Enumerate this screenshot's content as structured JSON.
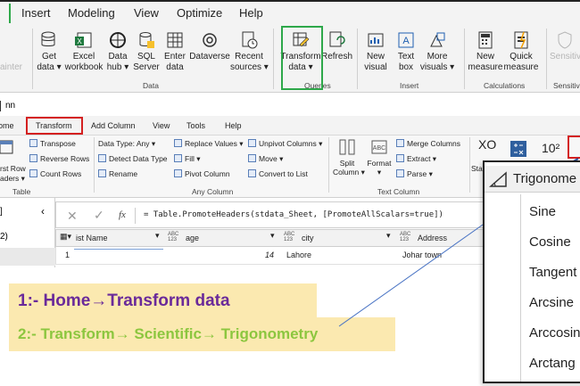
{
  "menu": {
    "items": [
      "Insert",
      "Modeling",
      "View",
      "Optimize",
      "Help"
    ]
  },
  "ribbon": {
    "faded_left": "ainter",
    "buttons": [
      {
        "label": "Get\ndata ▾"
      },
      {
        "label": "Excel\nworkbook"
      },
      {
        "label": "Data\nhub ▾"
      },
      {
        "label": "SQL\nServer"
      },
      {
        "label": "Enter\ndata"
      },
      {
        "label": "Dataverse"
      },
      {
        "label": "Recent\nsources ▾"
      },
      {
        "label": "Transform\ndata ▾"
      },
      {
        "label": "Refresh"
      },
      {
        "label": "New\nvisual"
      },
      {
        "label": "Text\nbox"
      },
      {
        "label": "More\nvisuals ▾"
      },
      {
        "label": "New\nmeasure"
      },
      {
        "label": "Quick\nmeasure"
      },
      {
        "label": "Sensitivi"
      }
    ],
    "groups": {
      "data": "Data",
      "queries": "Queries",
      "insert": "Insert",
      "calculations": "Calculations",
      "sensitivity": "Sensitivi"
    }
  },
  "editor": {
    "title_fragment": "nn",
    "tabs": [
      "ome",
      "Transform",
      "Add Column",
      "View",
      "Tools",
      "Help"
    ],
    "table_group": {
      "items": [
        "rst Row",
        "aders ▾"
      ],
      "transpose": "Transpose",
      "reverse_rows": "Reverse Rows",
      "count_rows": "Count Rows",
      "label": "Table"
    },
    "any_column": {
      "data_type": "Data Type: Any ▾",
      "detect": "Detect Data Type",
      "rename": "Rename",
      "replace": "Replace Values ▾",
      "fill": "Fill ▾",
      "pivot": "Pivot Column",
      "unpivot": "Unpivot Columns ▾",
      "move": "Move ▾",
      "convert": "Convert to List",
      "label": "Any Column"
    },
    "text_column": {
      "split": "Split\nColumn ▾",
      "format": "Format\n▾",
      "merge": "Merge Columns",
      "extract": "Extract ▾",
      "parse": "Parse ▾",
      "label": "Text Column"
    },
    "extra": {
      "sta": "Sta",
      "xo": "XO",
      "ten": "10²"
    },
    "formula": "= Table.PromoteHeaders(stdata_Sheet, [PromoteAllScalars=true])",
    "fx": "fx",
    "left_pane_num": "2)",
    "columns": [
      {
        "type": "",
        "name": "ist Name"
      },
      {
        "type": "ABC\n123",
        "name": "age"
      },
      {
        "type": "ABC\n123",
        "name": "city"
      },
      {
        "type": "ABC\n123",
        "name": "Address"
      }
    ],
    "row": {
      "index": "1",
      "age": "14",
      "city": "Lahore",
      "address": "Johar town"
    }
  },
  "annotations": {
    "step1": "1:- Home→Transform data",
    "step2": "2:- Transform→ Scientific→ Trigonometry",
    "step1_color": "#6a2a9a",
    "step2_color": "#8cc63f"
  },
  "popup": {
    "title": "Trigonome",
    "items": [
      "Sine",
      "Cosine",
      "Tangent",
      "Arcsine",
      "Arccosin",
      "Arctang"
    ]
  }
}
